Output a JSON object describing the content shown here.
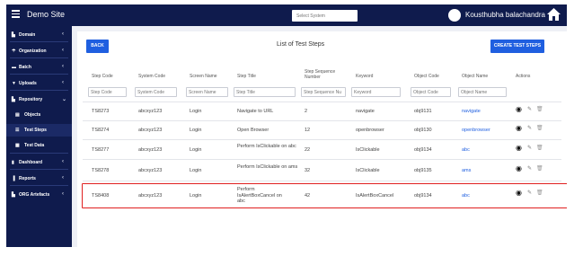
{
  "header": {
    "app_title": "Demo Site",
    "search_placeholder": "Select System",
    "user_name": "Kousthubha balachandra"
  },
  "sidebar": {
    "items": [
      {
        "label": "Domain",
        "icon": "building-icon"
      },
      {
        "label": "Organization",
        "icon": "umbrella-icon"
      },
      {
        "label": "Batch",
        "icon": "folder-icon"
      },
      {
        "label": "Uploads",
        "icon": "filter-icon"
      },
      {
        "label": "Repository",
        "icon": "building-icon"
      },
      {
        "label": "Objects",
        "icon": "database-icon"
      },
      {
        "label": "Test Steps",
        "icon": "list-icon"
      },
      {
        "label": "Test Data",
        "icon": "org-icon"
      },
      {
        "label": "Dashboard",
        "icon": "chart-icon"
      },
      {
        "label": "Reports",
        "icon": "file-icon"
      },
      {
        "label": "ORG Artefacts",
        "icon": "building-icon"
      }
    ]
  },
  "main": {
    "back_label": "BACK",
    "title": "List of Test Steps",
    "create_label": "CREATE TEST STEPS",
    "columns": [
      "Step Code",
      "System Code",
      "Screen Name",
      "Step Title",
      "Step Sequence Number",
      "Keyword",
      "Object Code",
      "Object Name",
      "Actions"
    ],
    "filters": [
      "Step Code",
      "System Code",
      "Screen Name",
      "Step Title",
      "Step Sequence Nu",
      "Keyword",
      "Object Code",
      "Object Name"
    ],
    "rows": [
      {
        "step_code": "TS8273",
        "system_code": "abcxyz123",
        "screen_name": "Login",
        "step_title": "Navigate to URL",
        "sequence": "2",
        "keyword": "navigate",
        "object_code": "obj9131",
        "object_name": "navigate"
      },
      {
        "step_code": "TS8274",
        "system_code": "abcxyz123",
        "screen_name": "Login",
        "step_title": "Open Browser",
        "sequence": "12",
        "keyword": "openbrowser",
        "object_code": "obj9130",
        "object_name": "openbrowser"
      },
      {
        "step_code": "TS8277",
        "system_code": "abcxyz123",
        "screen_name": "Login",
        "step_title": "Perform IsClickable on abc",
        "sequence": "22",
        "keyword": "IsClickable",
        "object_code": "obj9134",
        "object_name": "abc"
      },
      {
        "step_code": "TS8278",
        "system_code": "abcxyz123",
        "screen_name": "Login",
        "step_title": "Perform IsClickable on ams",
        "sequence": "32",
        "keyword": "IsClickable",
        "object_code": "obj9135",
        "object_name": "ams"
      },
      {
        "step_code": "TS8408",
        "system_code": "abcxyz123",
        "screen_name": "Login",
        "step_title": "Perform IsAlertBoxCancel on abc",
        "sequence": "42",
        "keyword": "IsAlertBoxCancel",
        "object_code": "obj9134",
        "object_name": "abc"
      }
    ]
  },
  "colors": {
    "sidebar_bg": "#0f1b4d",
    "primary_button": "#1f5fe0",
    "link": "#1f5fe0",
    "highlight_border": "#e02020"
  }
}
